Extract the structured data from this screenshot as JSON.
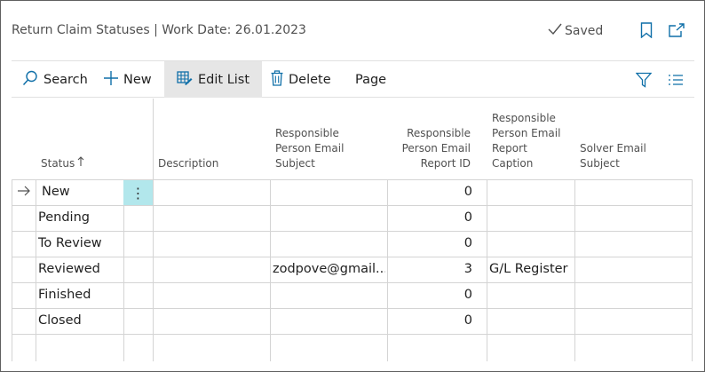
{
  "header": {
    "title": "Return Claim Statuses | Work Date: 26.01.2023",
    "saved_label": "Saved",
    "bookmark_icon": "bookmark-icon",
    "open_new_window_icon": "open-in-new-window-icon"
  },
  "actions": {
    "search": "Search",
    "new": "New",
    "edit_list": "Edit List",
    "delete": "Delete",
    "page": "Page"
  },
  "columns": {
    "status": "Status",
    "description": "Description",
    "rpe_subject": [
      "Responsible",
      "Person Email",
      "Subject"
    ],
    "rpe_report_id": [
      "Responsible",
      "Person Email",
      "Report ID"
    ],
    "rpe_report_caption": [
      "Responsible",
      "Person Email",
      "Report",
      "Caption"
    ],
    "solver_email_subject": [
      "Solver Email",
      "Subject"
    ]
  },
  "rows": [
    {
      "status": "New",
      "description": "",
      "rpe_subject": "",
      "report_id": "0",
      "report_caption": "",
      "solver_subject": ""
    },
    {
      "status": "Pending",
      "description": "",
      "rpe_subject": "",
      "report_id": "0",
      "report_caption": "",
      "solver_subject": ""
    },
    {
      "status": "To Review",
      "description": "",
      "rpe_subject": "",
      "report_id": "0",
      "report_caption": "",
      "solver_subject": ""
    },
    {
      "status": "Reviewed",
      "description": "",
      "rpe_subject": "zodpove@gmail....",
      "report_id": "3",
      "report_caption": "G/L Register",
      "solver_subject": ""
    },
    {
      "status": "Finished",
      "description": "",
      "rpe_subject": "",
      "report_id": "0",
      "report_caption": "",
      "solver_subject": ""
    },
    {
      "status": "Closed",
      "description": "",
      "rpe_subject": "",
      "report_id": "0",
      "report_caption": "",
      "solver_subject": ""
    }
  ],
  "colors": {
    "accent": "#0f6fa8",
    "row_menu_bg": "#b2e7ec",
    "active_action_bg": "#e6e6e6"
  }
}
